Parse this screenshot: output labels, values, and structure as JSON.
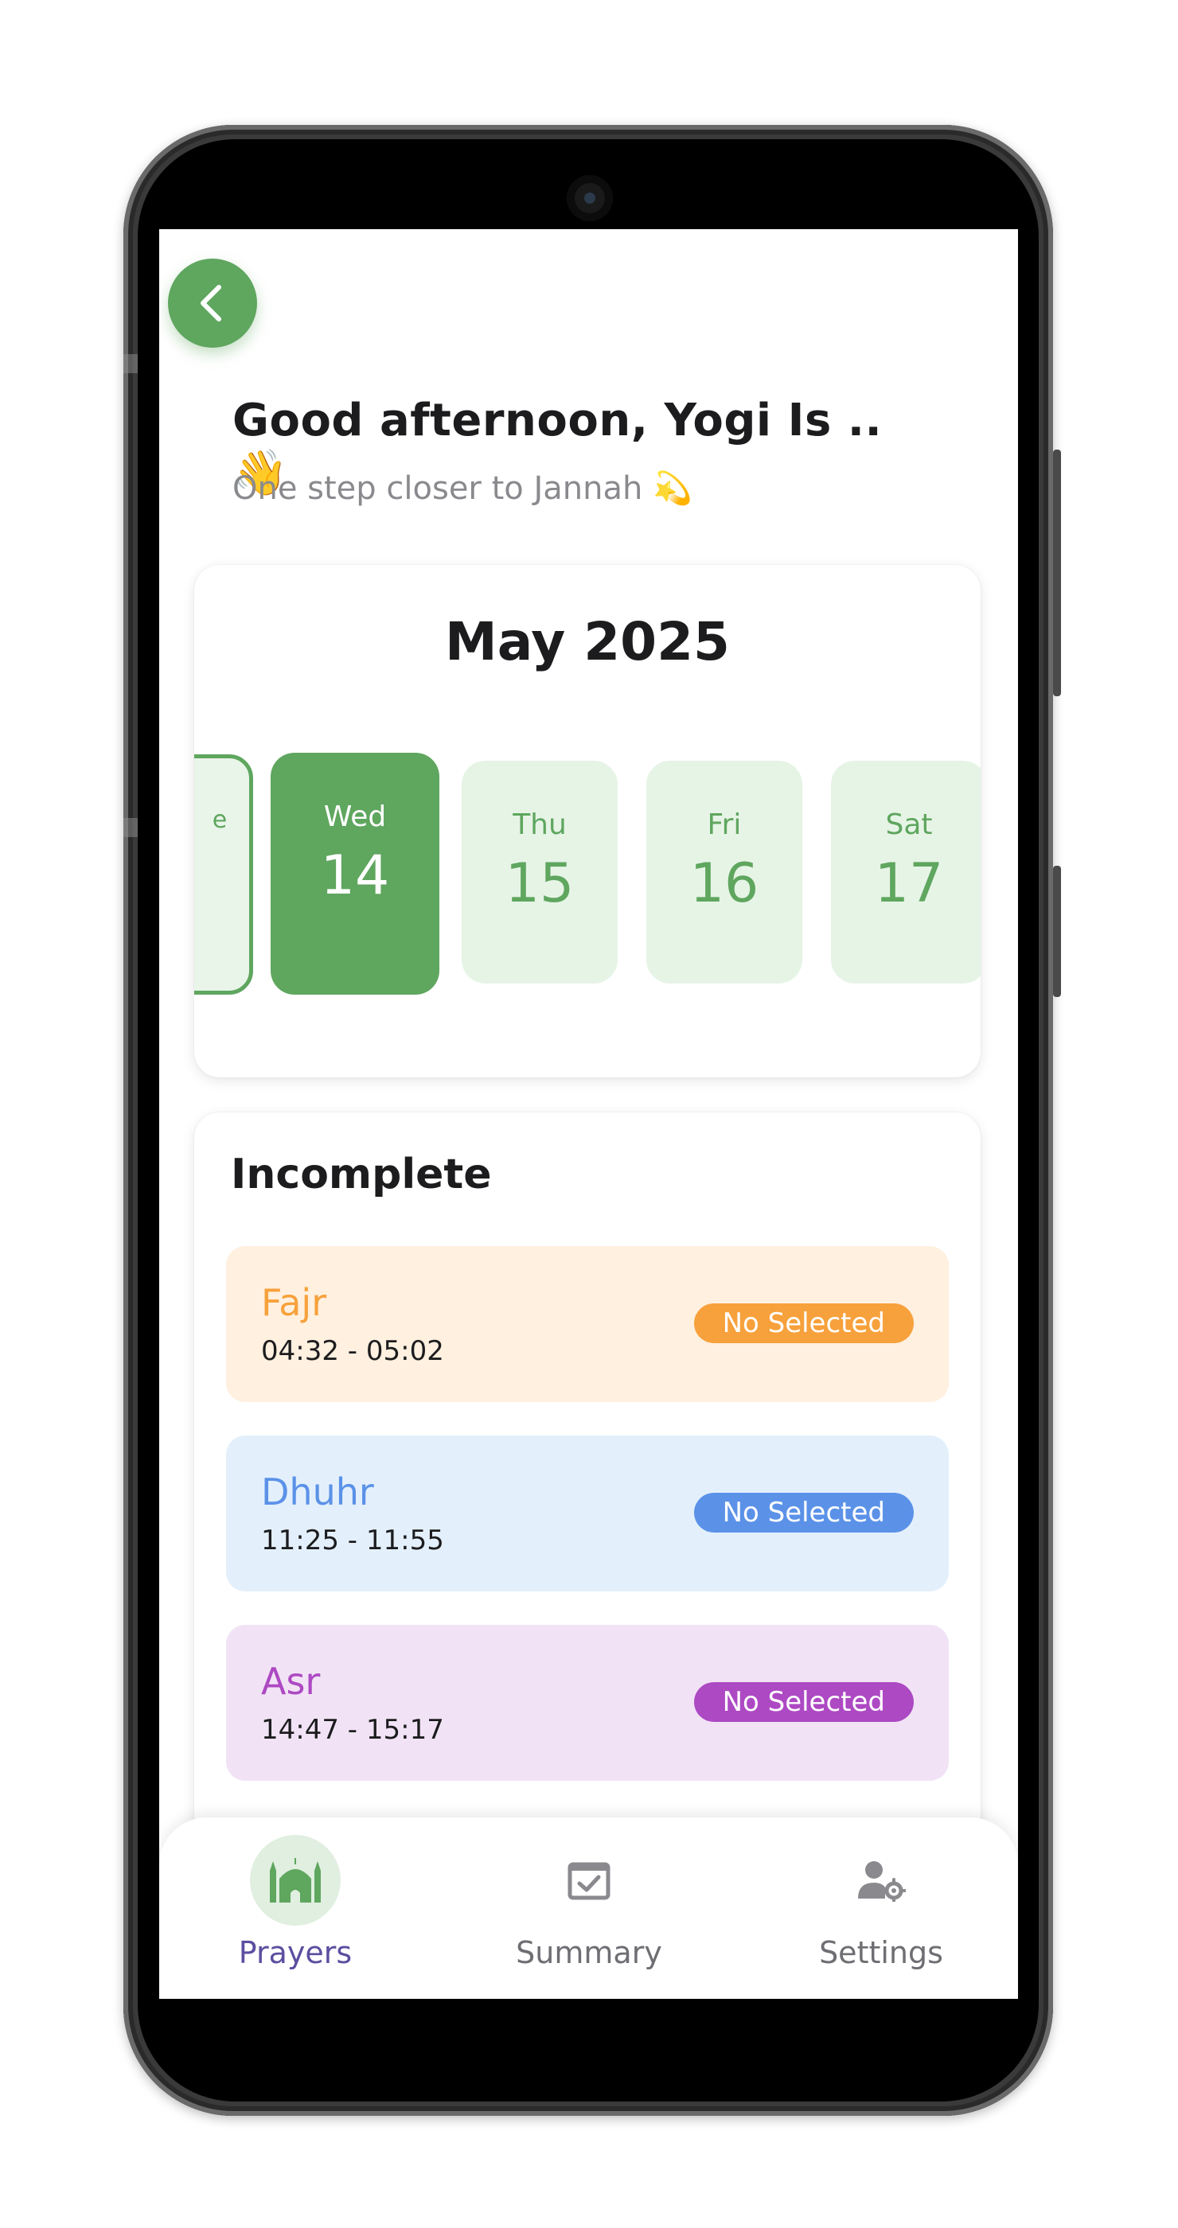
{
  "header": {
    "greeting": "Good afternoon, Yogi Is .. 👋",
    "subtitle": "One step closer to Jannah 💫"
  },
  "calendar": {
    "month_label": "May 2025",
    "partial_day_label": "e",
    "days": [
      {
        "name": "Wed",
        "date": "14"
      },
      {
        "name": "Thu",
        "date": "15"
      },
      {
        "name": "Fri",
        "date": "16"
      },
      {
        "name": "Sat",
        "date": "17"
      }
    ],
    "selected_index": 0
  },
  "incomplete": {
    "title": "Incomplete",
    "prayers": [
      {
        "name": "Fajr",
        "time": "04:32 - 05:02",
        "status": "No Selected",
        "bg": "#fff0df",
        "accent": "#f7a13c"
      },
      {
        "name": "Dhuhr",
        "time": "11:25 - 11:55",
        "status": "No Selected",
        "bg": "#e3f0fc",
        "accent": "#5b92e8"
      },
      {
        "name": "Asr",
        "time": "14:47 - 15:17",
        "status": "No Selected",
        "bg": "#f1e3f5",
        "accent": "#ad49c3"
      }
    ]
  },
  "nav": {
    "items": [
      {
        "label": "Prayers",
        "icon": "mosque-icon",
        "active": true
      },
      {
        "label": "Summary",
        "icon": "calendar-check-icon",
        "active": false
      },
      {
        "label": "Settings",
        "icon": "user-gear-icon",
        "active": false
      }
    ]
  },
  "colors": {
    "primary": "#5fa65f",
    "primary_light": "#e6f4e6",
    "nav_active": "#5d4ea0"
  }
}
